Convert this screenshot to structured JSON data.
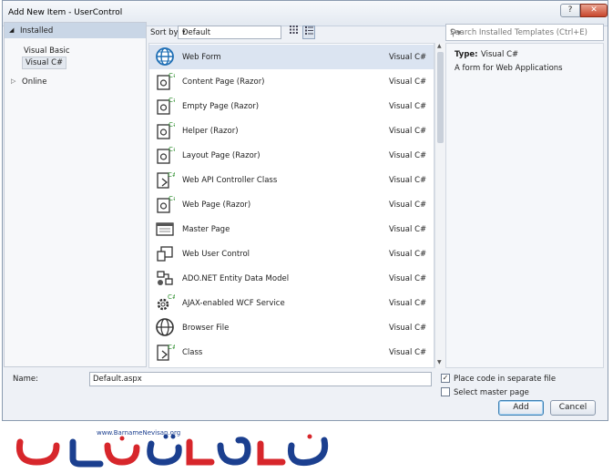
{
  "title": "Add New Item - UserControl",
  "titlebar": {
    "help": "?",
    "close": "✕"
  },
  "left": {
    "installed": "Installed",
    "items": [
      "Visual Basic",
      "Visual C#"
    ],
    "online": "Online"
  },
  "sort": {
    "label": "Sort by:",
    "value": "Default"
  },
  "search": {
    "placeholder": "Search Installed Templates (Ctrl+E)"
  },
  "templates": [
    {
      "name": "Web Form",
      "type": "Visual C#",
      "icon": "globe-icon"
    },
    {
      "name": "Content Page (Razor)",
      "type": "Visual C#",
      "icon": "razor-page-icon"
    },
    {
      "name": "Empty Page (Razor)",
      "type": "Visual C#",
      "icon": "razor-page-icon"
    },
    {
      "name": "Helper (Razor)",
      "type": "Visual C#",
      "icon": "razor-page-icon"
    },
    {
      "name": "Layout Page (Razor)",
      "type": "Visual C#",
      "icon": "razor-page-icon"
    },
    {
      "name": "Web API Controller Class",
      "type": "Visual C#",
      "icon": "class-file-icon"
    },
    {
      "name": "Web Page (Razor)",
      "type": "Visual C#",
      "icon": "razor-page-icon"
    },
    {
      "name": "Master Page",
      "type": "Visual C#",
      "icon": "master-page-icon"
    },
    {
      "name": "Web User Control",
      "type": "Visual C#",
      "icon": "user-control-icon"
    },
    {
      "name": "ADO.NET Entity Data Model",
      "type": "Visual C#",
      "icon": "entity-model-icon"
    },
    {
      "name": "AJAX-enabled WCF Service",
      "type": "Visual C#",
      "icon": "wcf-service-icon"
    },
    {
      "name": "Browser File",
      "type": "Visual C#",
      "icon": "globe-icon"
    },
    {
      "name": "Class",
      "type": "Visual C#",
      "icon": "class-file-icon"
    }
  ],
  "details": {
    "type_label": "Type:",
    "type_value": "Visual C#",
    "description": "A form for Web Applications"
  },
  "form": {
    "name_label": "Name:",
    "name_value": "Default.aspx",
    "place_code": "Place code in separate file",
    "place_code_checked": "✓",
    "master_page": "Select master page",
    "add": "Add",
    "cancel": "Cancel"
  },
  "logo": {
    "url": "www.BarnameNevisan.org"
  },
  "colors": {
    "selected_row": "#dbe4f1",
    "accent_blue": "#1f6fb5",
    "logo_red": "#d7262b",
    "logo_blue": "#1b3f8f"
  }
}
